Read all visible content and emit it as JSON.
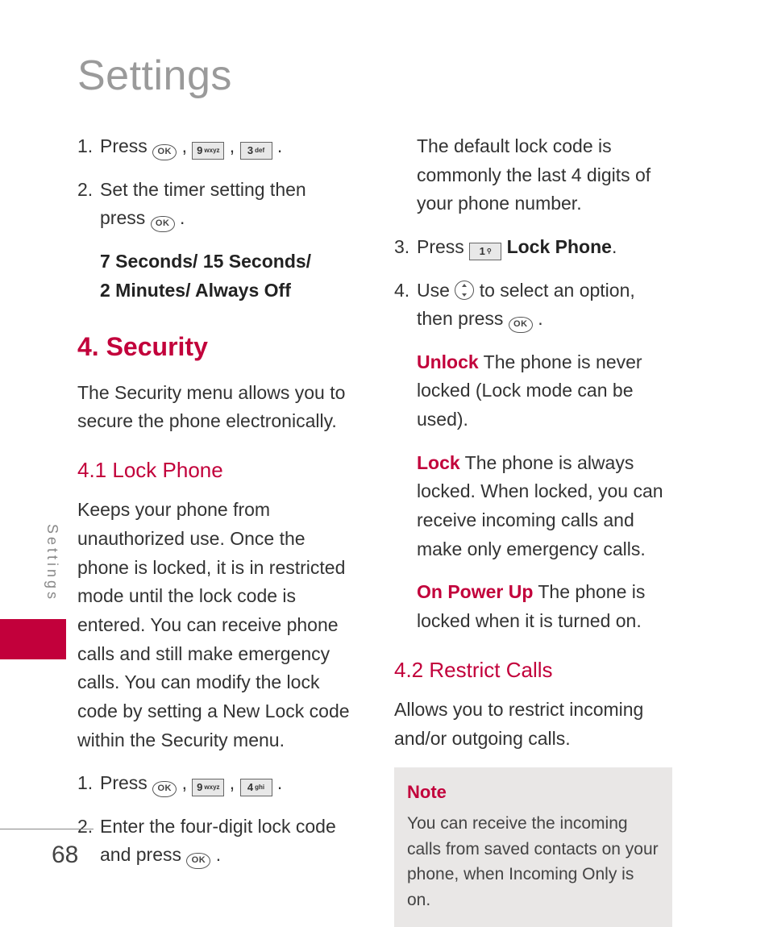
{
  "page_title": "Settings",
  "side_label": "Settings",
  "page_number": "68",
  "left": {
    "step1_n": "1.",
    "step1_a": "Press ",
    "step1_b": " , ",
    "step1_c": " , ",
    "step1_d": " .",
    "key9_n": "9",
    "key9_l": "wxyz",
    "key3_n": "3",
    "key3_l": "def",
    "key4_n": "4",
    "key4_l": "ghi",
    "step2_n": "2.",
    "step2_a": "Set the timer setting then press ",
    "step2_b": " .",
    "options_l1": "7 Seconds/ 15 Seconds/",
    "options_l2": "2 Minutes/ Always Off",
    "sec_h": "4. Security",
    "sec_p": "The Security menu allows you to secure the phone electronically.",
    "lock_h": "4.1 Lock Phone",
    "lock_p": "Keeps your phone from unauthorized use. Once the phone is locked, it is in restricted mode until the lock code is entered. You can receive phone calls and still make emergency calls. You can modify the lock code by setting a New Lock code within the Security menu.",
    "lstep1_n": "1.",
    "lstep1_a": "Press ",
    "lstep2_n": "2.",
    "lstep2_a": "Enter the four-digit lock code and press ",
    "lstep2_b": " ."
  },
  "right": {
    "default_p": "The default lock code is commonly the last 4 digits of your phone number.",
    "step3_n": "3.",
    "step3_a": "Press ",
    "key1_n": "1",
    "key1_l": "",
    "step3_b": "Lock Phone",
    "step3_c": ".",
    "step4_n": "4.",
    "step4_a": "Use ",
    "step4_b": " to select an option, then press ",
    "step4_c": " .",
    "unlock_lead": "Unlock",
    "unlock_t": " The phone is never locked (Lock mode can be used).",
    "lock_lead": "Lock",
    "lock_t": " The phone is always locked. When locked, you can receive incoming calls and make only emergency calls.",
    "power_lead": "On Power Up",
    "power_t": " The phone is locked when it is turned on.",
    "restrict_h": "4.2 Restrict Calls",
    "restrict_p": "Allows you to restrict incoming and/or outgoing calls.",
    "note_title": "Note",
    "note_body": "You can receive the incoming calls from saved contacts on your phone, when Incoming Only is on."
  }
}
